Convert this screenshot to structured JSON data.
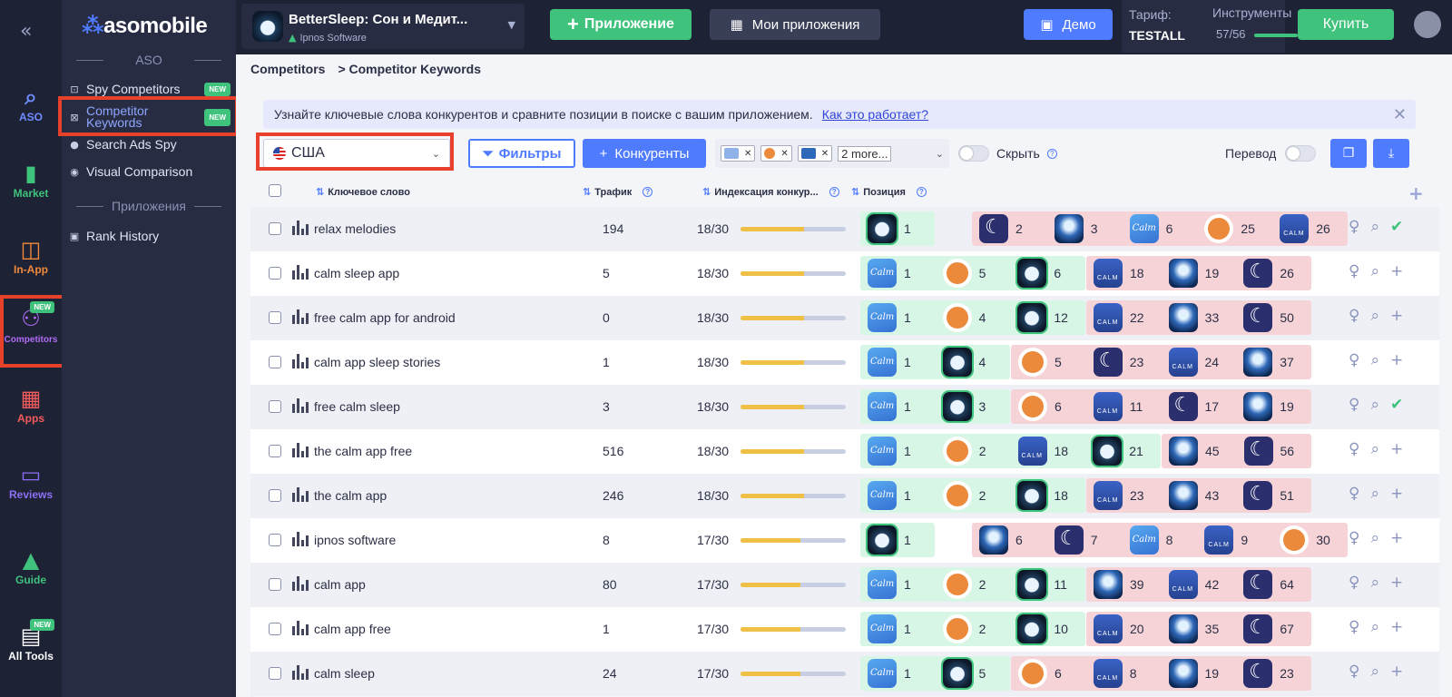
{
  "rail": {
    "items": [
      {
        "icon": "search-icon",
        "label": "ASO",
        "color": "#6f8cff"
      },
      {
        "icon": "bar-chart-icon",
        "label": "Market",
        "color": "#3fc37c"
      },
      {
        "icon": "shopping-bag-icon",
        "label": "In-App",
        "color": "#f28a3b"
      },
      {
        "icon": "competitors-icon",
        "label": "Competitors",
        "color": "#b06cf5",
        "badge": "NEW"
      },
      {
        "icon": "apps-grid-icon",
        "label": "Apps",
        "color": "#f25b5b"
      },
      {
        "icon": "chat-icon",
        "label": "Reviews",
        "color": "#8c6ff5"
      },
      {
        "icon": "graduation-cap-icon",
        "label": "Guide",
        "color": "#3fc37c"
      },
      {
        "icon": "tools-icon",
        "label": "All Tools",
        "color": "#ffffff",
        "badge": "NEW"
      }
    ]
  },
  "sidebar": {
    "logo": "asomobile",
    "section_aso": "ASO",
    "items": [
      {
        "icon": "spy-icon",
        "label": "Spy Competitors",
        "badge": "NEW"
      },
      {
        "icon": "keywords-icon",
        "label": "Competitor Keywords",
        "badge": "NEW"
      },
      {
        "icon": "apple-icon",
        "label": "Search Ads Spy"
      },
      {
        "icon": "eye-icon",
        "label": "Visual Comparison"
      }
    ],
    "section_apps": "Приложения",
    "apps_items": [
      {
        "icon": "rank-history-icon",
        "label": "Rank History"
      }
    ]
  },
  "header": {
    "app_title": "BetterSleep: Сон и Медит...",
    "app_dev": "Ipnos Software",
    "add_app": "Приложение",
    "my_apps": "Мои приложения",
    "demo": "Демо",
    "plan_label": "Тариф:",
    "plan_value": "TESTALL",
    "tools_label": "Инструменты",
    "tools_value": "57/56",
    "tools_fraction": 1.0,
    "buy": "Купить"
  },
  "breadcrumb": {
    "root": "Competitors",
    "current": "> Competitor Keywords"
  },
  "info": {
    "text": "Узнайте ключевые слова конкурентов и сравните позиции в поиске с вашим приложением.",
    "link": "Как это работает?"
  },
  "controls": {
    "country": "США",
    "filters": "Фильтры",
    "competitors": "Конкуренты",
    "chips_more": "2 more...",
    "hide": "Скрыть",
    "translate": "Перевод"
  },
  "table": {
    "headers": {
      "keyword": "Ключевое слово",
      "traffic": "Трафик",
      "indexing": "Индексация конкур...",
      "position": "Позиция"
    },
    "rows": [
      {
        "keyword": "relax melodies",
        "traffic": "194",
        "index": "18/30",
        "fill": 0.6,
        "action": "check",
        "groups": [
          {
            "c": "g",
            "apps": [
              [
                "bs",
                "1"
              ]
            ]
          },
          {
            "c": "r",
            "apps": [
              [
                "moon",
                "2"
              ],
              [
                "ocean",
                "3"
              ],
              [
                "calm",
                "6"
              ],
              [
                "ora",
                "25"
              ],
              [
                "calm2",
                "26"
              ]
            ]
          }
        ]
      },
      {
        "keyword": "calm sleep app",
        "traffic": "5",
        "index": "18/30",
        "fill": 0.6,
        "action": "plus",
        "groups": [
          {
            "c": "g",
            "apps": [
              [
                "calm",
                "1"
              ],
              [
                "ora",
                "5"
              ],
              [
                "bs",
                "6"
              ]
            ]
          },
          {
            "c": "r",
            "apps": [
              [
                "calm2",
                "18"
              ],
              [
                "ocean",
                "19"
              ],
              [
                "moon",
                "26"
              ]
            ]
          }
        ]
      },
      {
        "keyword": "free calm app for android",
        "traffic": "0",
        "index": "18/30",
        "fill": 0.6,
        "action": "plus",
        "groups": [
          {
            "c": "g",
            "apps": [
              [
                "calm",
                "1"
              ],
              [
                "ora",
                "4"
              ],
              [
                "bs",
                "12"
              ]
            ]
          },
          {
            "c": "r",
            "apps": [
              [
                "calm2",
                "22"
              ],
              [
                "ocean",
                "33"
              ],
              [
                "moon",
                "50"
              ]
            ]
          }
        ]
      },
      {
        "keyword": "calm app sleep stories",
        "traffic": "1",
        "index": "18/30",
        "fill": 0.6,
        "action": "plus",
        "groups": [
          {
            "c": "g",
            "apps": [
              [
                "calm",
                "1"
              ],
              [
                "bs",
                "4"
              ]
            ]
          },
          {
            "c": "r",
            "apps": [
              [
                "ora",
                "5"
              ],
              [
                "moon",
                "23"
              ],
              [
                "calm2",
                "24"
              ],
              [
                "ocean",
                "37"
              ]
            ]
          }
        ]
      },
      {
        "keyword": "free calm sleep",
        "traffic": "3",
        "index": "18/30",
        "fill": 0.6,
        "action": "check",
        "groups": [
          {
            "c": "g",
            "apps": [
              [
                "calm",
                "1"
              ],
              [
                "bs",
                "3"
              ]
            ]
          },
          {
            "c": "r",
            "apps": [
              [
                "ora",
                "6"
              ],
              [
                "calm2",
                "11"
              ],
              [
                "moon",
                "17"
              ],
              [
                "ocean",
                "19"
              ]
            ]
          }
        ]
      },
      {
        "keyword": "the calm app free",
        "traffic": "516",
        "index": "18/30",
        "fill": 0.6,
        "action": "plus",
        "groups": [
          {
            "c": "g",
            "apps": [
              [
                "calm",
                "1"
              ],
              [
                "ora",
                "2"
              ],
              [
                "calm2",
                "18"
              ],
              [
                "bs",
                "21"
              ]
            ]
          },
          {
            "c": "r",
            "apps": [
              [
                "ocean",
                "45"
              ],
              [
                "moon",
                "56"
              ]
            ]
          }
        ]
      },
      {
        "keyword": "the calm app",
        "traffic": "246",
        "index": "18/30",
        "fill": 0.6,
        "action": "plus",
        "groups": [
          {
            "c": "g",
            "apps": [
              [
                "calm",
                "1"
              ],
              [
                "ora",
                "2"
              ],
              [
                "bs",
                "18"
              ]
            ]
          },
          {
            "c": "r",
            "apps": [
              [
                "calm2",
                "23"
              ],
              [
                "ocean",
                "43"
              ],
              [
                "moon",
                "51"
              ]
            ]
          }
        ]
      },
      {
        "keyword": "ipnos software",
        "traffic": "8",
        "index": "17/30",
        "fill": 0.57,
        "action": "plus",
        "groups": [
          {
            "c": "g",
            "apps": [
              [
                "bs",
                "1"
              ]
            ]
          },
          {
            "c": "r",
            "apps": [
              [
                "ocean",
                "6"
              ],
              [
                "moon",
                "7"
              ],
              [
                "calm",
                "8"
              ],
              [
                "calm2",
                "9"
              ],
              [
                "ora",
                "30"
              ]
            ]
          }
        ]
      },
      {
        "keyword": "calm app",
        "traffic": "80",
        "index": "17/30",
        "fill": 0.57,
        "action": "plus",
        "groups": [
          {
            "c": "g",
            "apps": [
              [
                "calm",
                "1"
              ],
              [
                "ora",
                "2"
              ],
              [
                "bs",
                "11"
              ]
            ]
          },
          {
            "c": "r",
            "apps": [
              [
                "ocean",
                "39"
              ],
              [
                "calm2",
                "42"
              ],
              [
                "moon",
                "64"
              ]
            ]
          }
        ]
      },
      {
        "keyword": "calm app free",
        "traffic": "1",
        "index": "17/30",
        "fill": 0.57,
        "action": "plus",
        "groups": [
          {
            "c": "g",
            "apps": [
              [
                "calm",
                "1"
              ],
              [
                "ora",
                "2"
              ],
              [
                "bs",
                "10"
              ]
            ]
          },
          {
            "c": "r",
            "apps": [
              [
                "calm2",
                "20"
              ],
              [
                "ocean",
                "35"
              ],
              [
                "moon",
                "67"
              ]
            ]
          }
        ]
      },
      {
        "keyword": "calm sleep",
        "traffic": "24",
        "index": "17/30",
        "fill": 0.57,
        "action": "plus",
        "groups": [
          {
            "c": "g",
            "apps": [
              [
                "calm",
                "1"
              ],
              [
                "bs",
                "5"
              ]
            ]
          },
          {
            "c": "r",
            "apps": [
              [
                "ora",
                "6"
              ],
              [
                "calm2",
                "8"
              ],
              [
                "ocean",
                "19"
              ],
              [
                "moon",
                "23"
              ]
            ]
          }
        ]
      }
    ]
  }
}
